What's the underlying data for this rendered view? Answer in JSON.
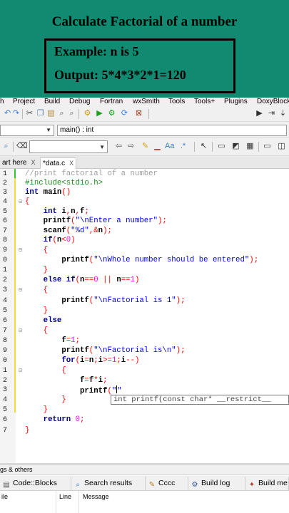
{
  "banner": {
    "title": "Calculate Factorial of a number",
    "example": "Example: n is 5",
    "output": "Output: 5*4*3*2*1=120"
  },
  "menu": [
    "h",
    "Project",
    "Build",
    "Debug",
    "Fortran",
    "wxSmith",
    "Tools",
    "Tools+",
    "Plugins",
    "DoxyBlock"
  ],
  "toolbar": {
    "function_combo": "main() : int"
  },
  "tabs": {
    "start": "art here",
    "file": "*data.c",
    "close": "X"
  },
  "editor": {
    "line_numbers": [
      "1",
      "2",
      "3",
      "4",
      "5",
      "6",
      "7",
      "8",
      "9",
      "0",
      "1",
      "2",
      "3",
      "4",
      "5",
      "6",
      "7",
      "8",
      "9",
      "0",
      "1",
      "2",
      "3",
      "4",
      "5",
      "6",
      "7"
    ],
    "tooltip": "int printf(const char* __restrict__"
  },
  "bottom": {
    "header": "gs & others",
    "tabs": [
      "Code::Blocks",
      "Search results",
      "Cccc",
      "Build log",
      "Build me"
    ],
    "columns": [
      "ile",
      "Line",
      "Message"
    ]
  }
}
